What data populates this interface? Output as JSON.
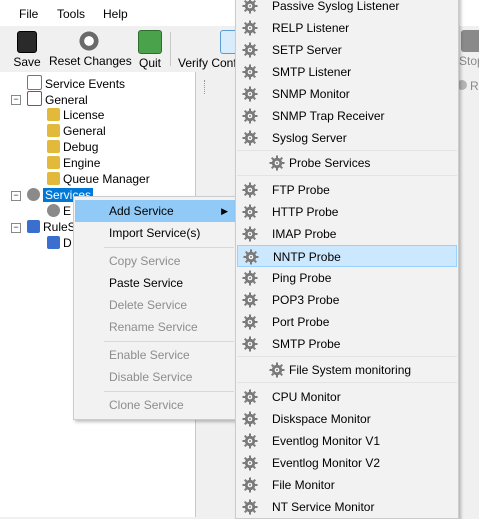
{
  "menubar": {
    "file": "File",
    "tools": "Tools",
    "help": "Help"
  },
  "toolbar": {
    "save": "Save",
    "reset": "Reset Changes",
    "quit": "Quit",
    "verify": "Verify Conf",
    "stop": "Stop",
    "r_partial": "R"
  },
  "tree": {
    "service_events": "Service Events",
    "general": "General",
    "license": "License",
    "general_child": "General",
    "debug": "Debug",
    "engine": "Engine",
    "queue_manager": "Queue Manager",
    "services": "Services",
    "services_child_partial": "E",
    "rulesets_partial": "RuleS",
    "rulesets_child_partial": "D"
  },
  "context_menu": {
    "add_service": "Add Service",
    "import_services": "Import Service(s)",
    "copy_service": "Copy Service",
    "paste_service": "Paste Service",
    "delete_service": "Delete Service",
    "rename_service": "Rename Service",
    "enable_service": "Enable Service",
    "disable_service": "Disable Service",
    "clone_service": "Clone Service"
  },
  "submenu": {
    "passive_syslog": "Passive Syslog Listener",
    "relp": "RELP Listener",
    "setp": "SETP Server",
    "smtp_listener": "SMTP Listener",
    "snmp_monitor": "SNMP Monitor",
    "snmp_trap": "SNMP Trap Receiver",
    "syslog_server": "Syslog Server",
    "probe_services": "Probe Services",
    "ftp_probe": "FTP Probe",
    "http_probe": "HTTP Probe",
    "imap_probe": "IMAP Probe",
    "nntp_probe": "NNTP Probe",
    "ping_probe": "Ping Probe",
    "pop3_probe": "POP3 Probe",
    "port_probe": "Port Probe",
    "smtp_probe": "SMTP Probe",
    "file_system_monitoring": "File  System monitoring",
    "cpu_monitor": "CPU Monitor",
    "diskspace_monitor": "Diskspace Monitor",
    "eventlog_v1": "Eventlog Monitor V1",
    "eventlog_v2": "Eventlog Monitor V2",
    "file_monitor": "File Monitor",
    "nt_service_monitor": "NT Service Monitor"
  },
  "colors": {
    "selection": "#0078d7",
    "menu_highlight": "#91c9f7",
    "submenu_highlight": "#cce8ff"
  }
}
